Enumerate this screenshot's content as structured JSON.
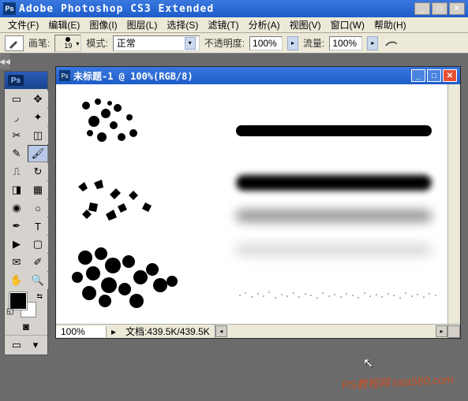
{
  "app": {
    "title": "Adobe Photoshop CS3 Extended",
    "ps_badge": "Ps"
  },
  "menu": {
    "file": "文件(F)",
    "edit": "编辑(E)",
    "image": "图像(I)",
    "layer": "图层(L)",
    "select": "选择(S)",
    "filter": "滤镜(T)",
    "analysis": "分析(A)",
    "view": "视图(V)",
    "window": "窗口(W)",
    "help": "帮助(H)"
  },
  "options": {
    "brush_label": "画笔:",
    "brush_size": "19",
    "mode_label": "模式:",
    "mode_value": "正常",
    "opacity_label": "不透明度:",
    "opacity_value": "100%",
    "flow_label": "流量:",
    "flow_value": "100%"
  },
  "toolbox": {
    "tools": [
      "marquee",
      "move",
      "lasso",
      "magic-wand",
      "crop",
      "slice",
      "healing",
      "brush",
      "stamp",
      "history-brush",
      "eraser",
      "gradient",
      "blur",
      "dodge",
      "pen",
      "type",
      "path-select",
      "shape",
      "notes",
      "eyedropper",
      "hand",
      "zoom"
    ],
    "badge": "Ps"
  },
  "document": {
    "title": "未标题-1 @ 100%(RGB/8)",
    "zoom": "100%",
    "info_label": "文档:",
    "info_value": "439.5K/439.5K"
  },
  "watermark": "PS教程网 tata580.com",
  "collapse": "◀◀"
}
